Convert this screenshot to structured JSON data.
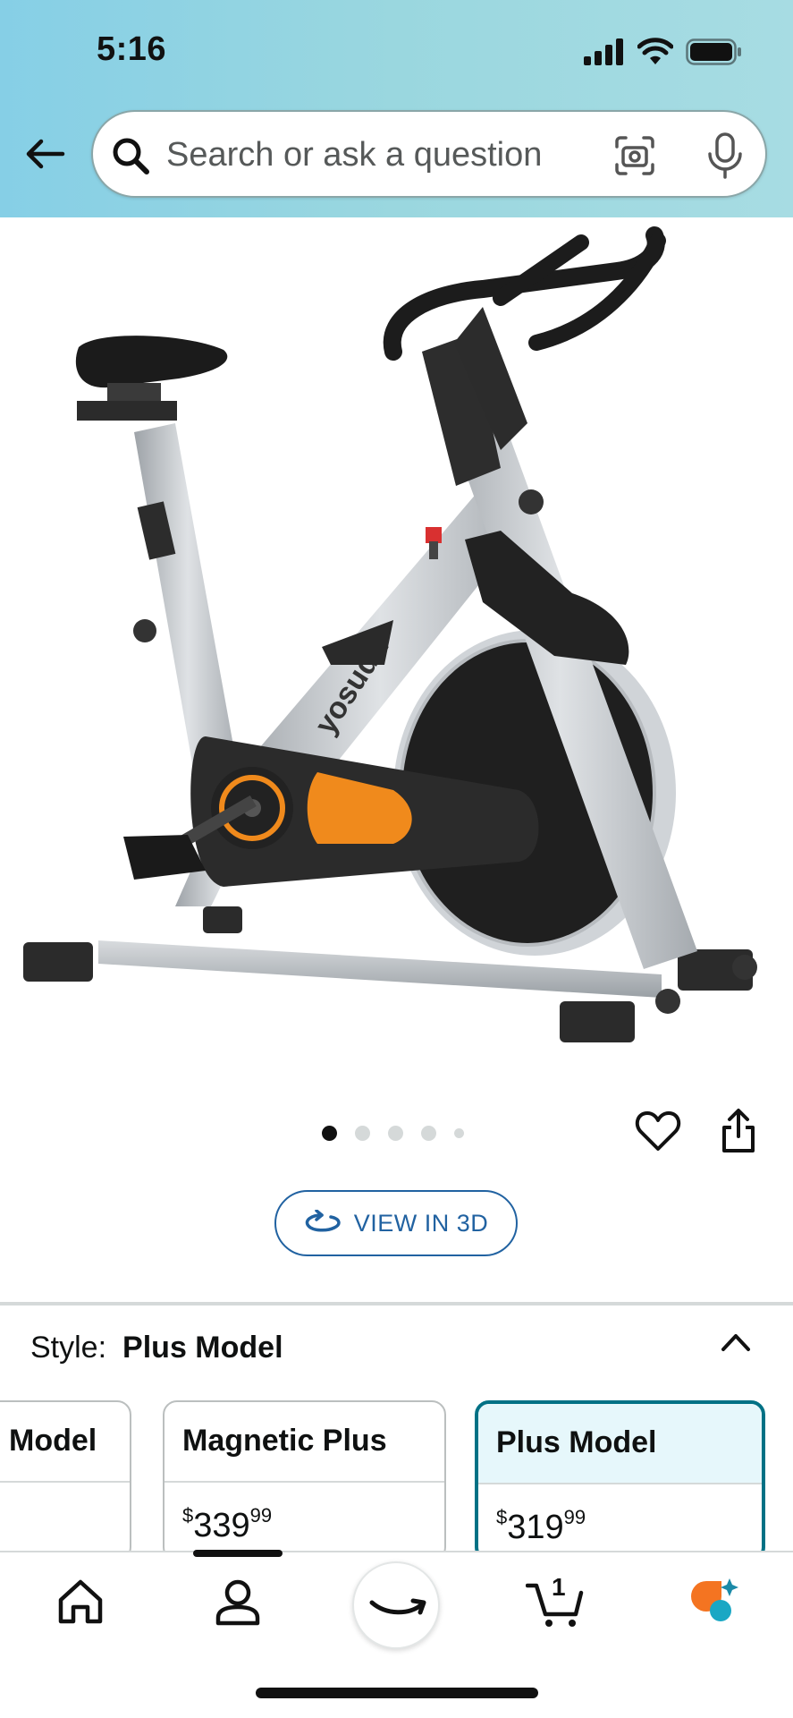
{
  "status_bar": {
    "time": "5:16"
  },
  "search": {
    "placeholder": "Search or ask a question",
    "value": ""
  },
  "product": {
    "image_brand_text": "yosuda",
    "carousel": {
      "total": 5,
      "active_index": 0
    },
    "view_3d_label": "VIEW IN 3D"
  },
  "style_selector": {
    "label": "Style:",
    "selected_value": "Plus Model",
    "options": [
      {
        "name": "Model",
        "price_symbol": "",
        "price_whole": "",
        "price_fraction": "",
        "selected": false
      },
      {
        "name": "Magnetic Plus",
        "price_symbol": "$",
        "price_whole": "339",
        "price_fraction": "99",
        "selected": false
      },
      {
        "name": "Plus Model",
        "price_symbol": "$",
        "price_whole": "319",
        "price_fraction": "99",
        "selected": true
      }
    ]
  },
  "bottom_nav": {
    "items": [
      "home-icon",
      "account-icon",
      "amazon-smile-icon",
      "cart-icon",
      "rufus-ai-icon"
    ],
    "cart_count": "1"
  },
  "colors": {
    "header_gradient_start": "#86cfe6",
    "header_gradient_end": "#a7dce3",
    "link_blue": "#2162a1",
    "selected_teal": "#007185",
    "selected_bg": "#e6f7fb",
    "bike_accent_orange": "#f08a1c"
  }
}
